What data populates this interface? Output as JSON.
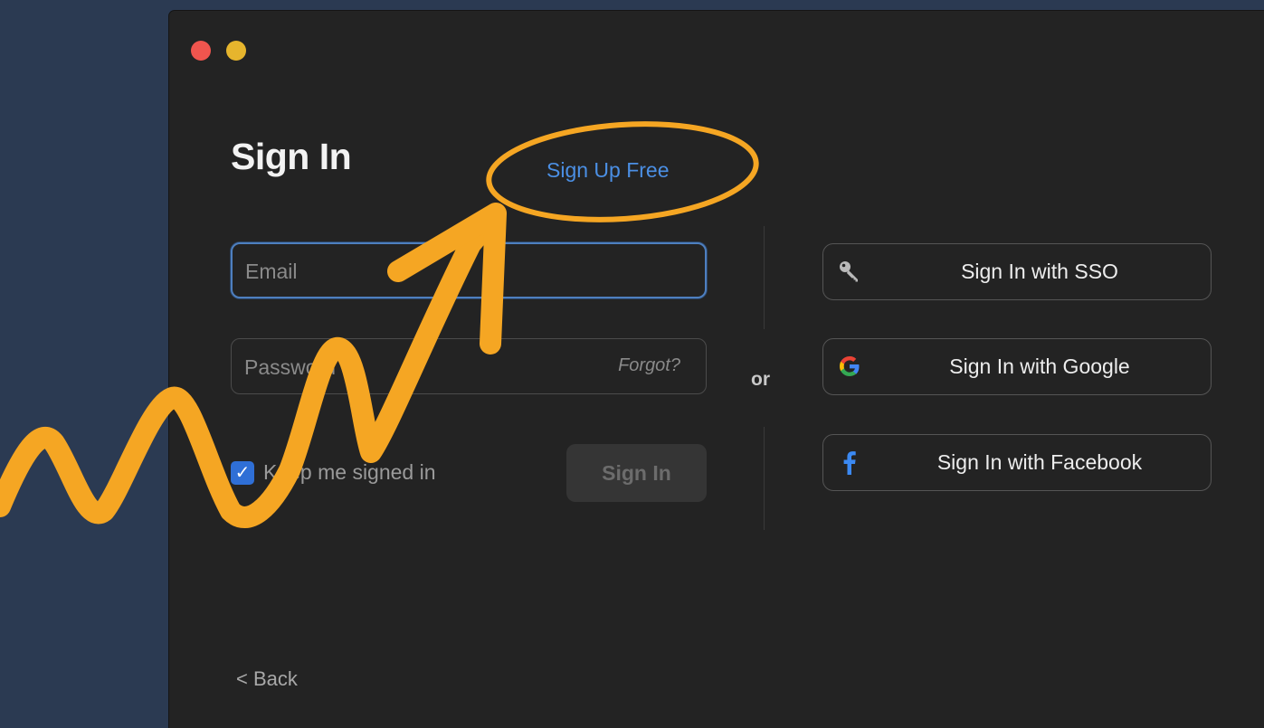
{
  "window": {
    "traffic_lights": [
      "close",
      "minimize"
    ]
  },
  "signin": {
    "title": "Sign In",
    "signup_link": "Sign Up Free",
    "email_placeholder": "Email",
    "password_placeholder": "Password",
    "forgot_label": "Forgot?",
    "keep_signed_in_label": "Keep me signed in",
    "keep_signed_in_checked": true,
    "submit_label": "Sign In"
  },
  "separator": {
    "label": "or"
  },
  "sso": [
    {
      "icon": "key-icon",
      "label": "Sign In with SSO"
    },
    {
      "icon": "google-icon",
      "label": "Sign In with Google"
    },
    {
      "icon": "facebook-icon",
      "label": "Sign In with Facebook"
    }
  ],
  "footer": {
    "back_label": "< Back"
  },
  "colors": {
    "background": "#2b3a52",
    "window": "#232323",
    "link": "#4b8fe4",
    "annotation": "#f5a623"
  }
}
